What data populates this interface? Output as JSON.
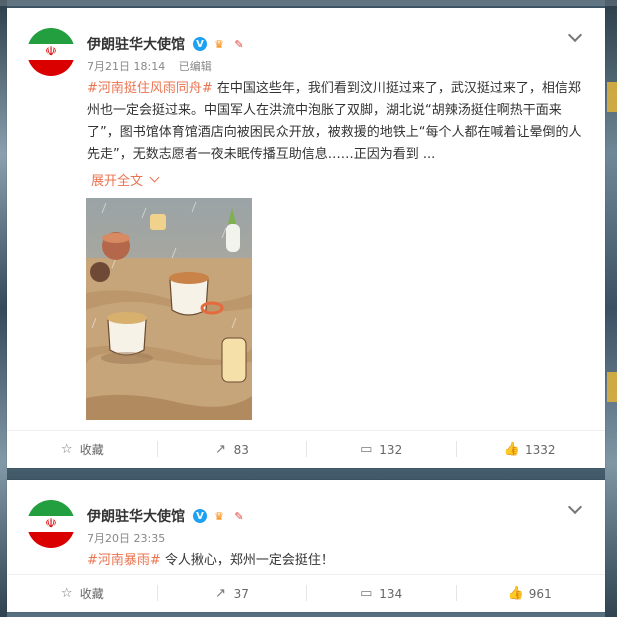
{
  "posts": [
    {
      "author": "伊朗驻华大使馆",
      "date": "7月21日 18:14",
      "edited": "已编辑",
      "hashtag": "#河南挺住风雨同舟#",
      "text": " 在中国这些年，我们看到汶川挺过来了，武汉挺过来了，相信郑州也一定会挺过来。中国军人在洪流中泡胀了双脚，湖北说“胡辣汤挺住啊热干面来了”，图书馆体育馆酒店向被困民众开放，被救援的地铁上“每个人都在喊着让晕倒的人先走”，无数志愿者一夜未眠传播互助信息……正因为看到 ...",
      "expand": "展开全文",
      "actions": {
        "favorite": "收藏",
        "repost": "83",
        "comment": "132",
        "like": "1332"
      }
    },
    {
      "author": "伊朗驻华大使馆",
      "date": "7月20日 23:35",
      "hashtag": "#河南暴雨#",
      "text": " 令人揪心，郑州一定会挺住！",
      "actions": {
        "favorite": "收藏",
        "repost": "37",
        "comment": "134",
        "like": "961"
      }
    }
  ],
  "icons": {
    "verified": "verified-v-icon",
    "vip": "crown-badge-icon",
    "fan": "fan-badge-icon",
    "favorite": "star-icon",
    "repost": "repost-icon",
    "comment": "comment-icon",
    "like": "thumbs-up-icon",
    "more": "chevron-down-icon"
  },
  "colors": {
    "link": "#eb7350",
    "verified": "#1da1f2"
  }
}
